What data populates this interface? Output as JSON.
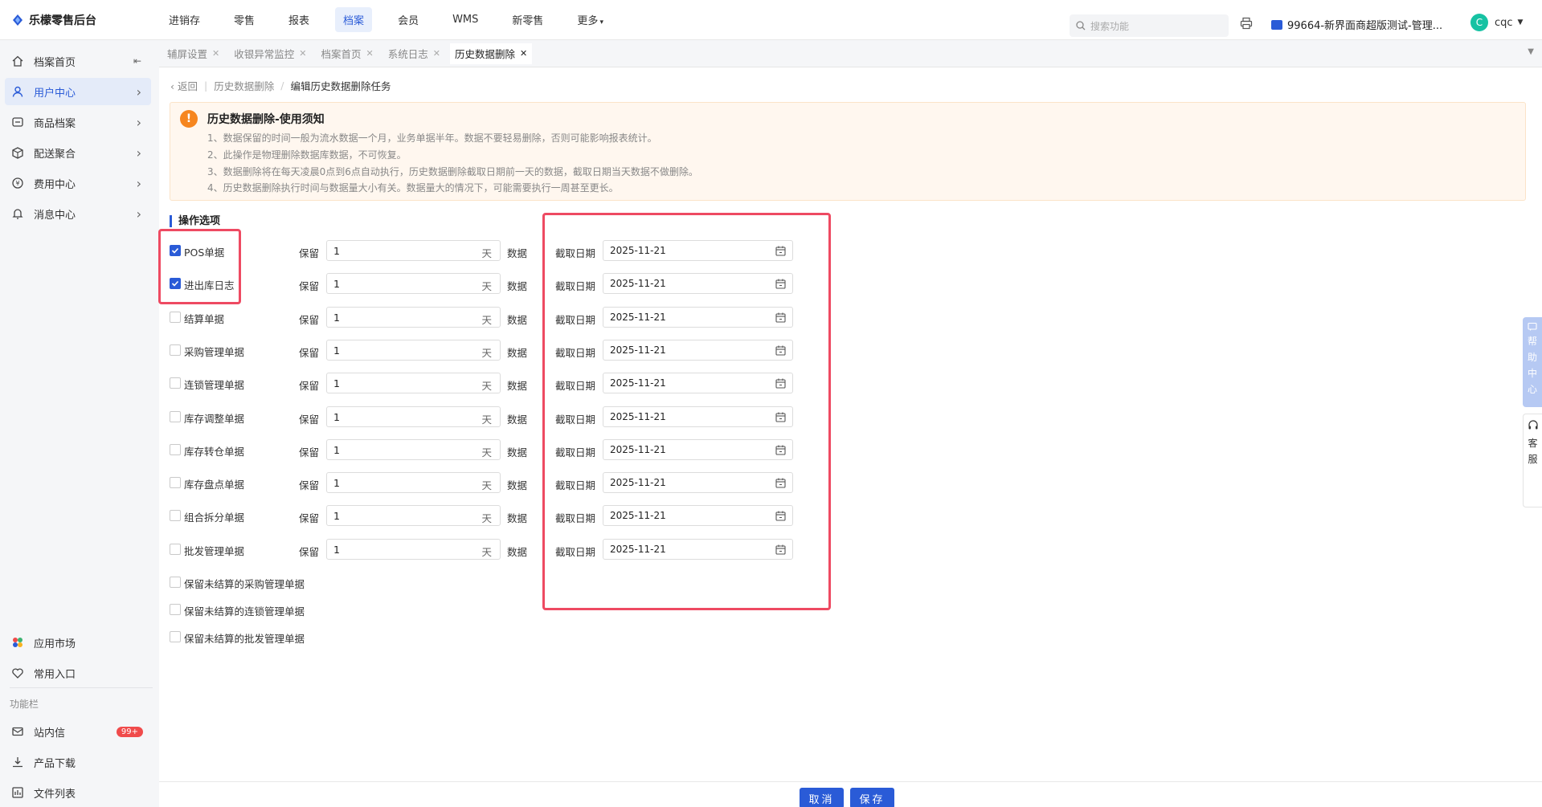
{
  "app": {
    "logo_text": "乐檬零售后台"
  },
  "nav": [
    "进销存",
    "零售",
    "报表",
    "档案",
    "会员",
    "WMS",
    "新零售",
    "更多"
  ],
  "nav_active_index": 3,
  "search": {
    "placeholder": "搜索功能"
  },
  "store": {
    "name": "99664-新界面商超版测试-管理..."
  },
  "user": {
    "avatar_letter": "C",
    "name": "cqc"
  },
  "sidebar": {
    "items": [
      {
        "label": "档案首页",
        "icon": "home-icon"
      },
      {
        "label": "用户中心",
        "icon": "user-icon"
      },
      {
        "label": "商品档案",
        "icon": "goods-icon"
      },
      {
        "label": "配送聚合",
        "icon": "delivery-icon"
      },
      {
        "label": "费用中心",
        "icon": "fee-icon"
      },
      {
        "label": "消息中心",
        "icon": "bell-icon"
      }
    ],
    "bottom": [
      {
        "label": "应用市场",
        "icon": "app-market-icon"
      },
      {
        "label": "常用入口",
        "icon": "heart-icon"
      }
    ],
    "group_title": "功能栏",
    "group_items": [
      {
        "label": "站内信",
        "icon": "mail-icon",
        "badge": "99+"
      },
      {
        "label": "产品下载",
        "icon": "download-icon"
      },
      {
        "label": "文件列表",
        "icon": "file-list-icon"
      }
    ]
  },
  "tabs": [
    "辅屏设置",
    "收银异常监控",
    "档案首页",
    "系统日志",
    "历史数据删除"
  ],
  "breadcrumb": {
    "back": "返回",
    "parent": "历史数据删除",
    "current": "编辑历史数据删除任务"
  },
  "notice": {
    "title": "历史数据删除-使用须知",
    "lines": [
      "1、数据保留的时间一般为流水数据一个月，业务单据半年。数据不要轻易删除，否则可能影响报表统计。",
      "2、此操作是物理删除数据库数据，不可恢复。",
      "3、数据删除将在每天凌晨0点到6点自动执行，历史数据删除截取日期前一天的数据，截取日期当天数据不做删除。",
      "4、历史数据删除执行时间与数据量大小有关。数据量大的情况下，可能需要执行一周甚至更长。"
    ]
  },
  "options": {
    "title": "操作选项",
    "keep_label": "保留",
    "unit": "天",
    "data_label": "数据",
    "cut_label": "截取日期",
    "rows": [
      {
        "label": "POS单据",
        "checked": true,
        "value": "1",
        "date": "2025-11-21"
      },
      {
        "label": "进出库日志",
        "checked": true,
        "value": "1",
        "date": "2025-11-21"
      },
      {
        "label": "结算单据",
        "checked": false,
        "value": "1",
        "date": "2025-11-21"
      },
      {
        "label": "采购管理单据",
        "checked": false,
        "value": "1",
        "date": "2025-11-21"
      },
      {
        "label": "连锁管理单据",
        "checked": false,
        "value": "1",
        "date": "2025-11-21"
      },
      {
        "label": "库存调整单据",
        "checked": false,
        "value": "1",
        "date": "2025-11-21"
      },
      {
        "label": "库存转仓单据",
        "checked": false,
        "value": "1",
        "date": "2025-11-21"
      },
      {
        "label": "库存盘点单据",
        "checked": false,
        "value": "1",
        "date": "2025-11-21"
      },
      {
        "label": "组合拆分单据",
        "checked": false,
        "value": "1",
        "date": "2025-11-21"
      },
      {
        "label": "批发管理单据",
        "checked": false,
        "value": "1",
        "date": "2025-11-21"
      }
    ],
    "extra": [
      {
        "label": "保留未结算的采购管理单据",
        "checked": false
      },
      {
        "label": "保留未结算的连锁管理单据",
        "checked": false
      },
      {
        "label": "保留未结算的批发管理单据",
        "checked": false
      }
    ]
  },
  "help": {
    "help_center": "帮助中心",
    "service": "客服"
  },
  "footer": {
    "cancel": "取消",
    "save": "保存"
  },
  "colors": {
    "primary": "#2a5bd7",
    "highlight": "#ee4a62",
    "notice_bg": "#fff7ef",
    "warning": "#f6861f"
  }
}
